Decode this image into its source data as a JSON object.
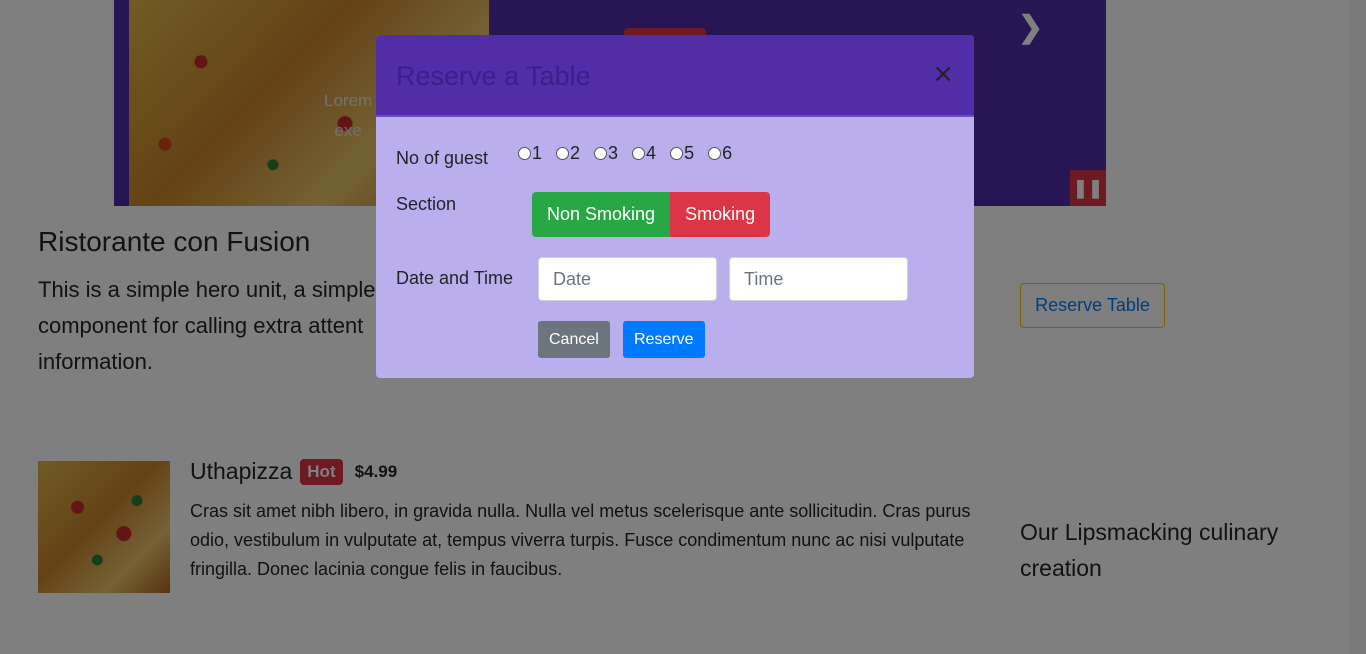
{
  "carousel": {
    "caption": "Lorem\nexe",
    "next_icon": "chevron-right-icon",
    "pause_icon": "pause-icon"
  },
  "hero": {
    "title": "Ristorante con Fusion",
    "lead": "This is a simple hero unit, a simple component for calling extra attent information.",
    "reserve_label": "Reserve Table"
  },
  "featured": {
    "title": "Uthapizza",
    "badge": "Hot",
    "price": "$4.99",
    "description": "Cras sit amet nibh libero, in gravida nulla. Nulla vel metus scelerisque ante sollicitudin. Cras purus odio, vestibulum in vulputate at, tempus viverra turpis. Fusce condimentum nunc ac nisi vulputate fringilla. Donec lacinia congue felis in faucibus.",
    "side_text": "Our Lipsmacking culinary creation"
  },
  "modal": {
    "title": "Reserve a Table",
    "close": "×",
    "guest_label": "No of guest",
    "guest_options": [
      "1",
      "2",
      "3",
      "4",
      "5",
      "6"
    ],
    "section_label": "Section",
    "section_options": [
      "Non Smoking",
      "Smoking"
    ],
    "datetime_label": "Date and Time",
    "date_placeholder": "Date",
    "time_placeholder": "Time",
    "cancel_label": "Cancel",
    "reserve_label": "Reserve"
  },
  "colors": {
    "brand": "#512da8",
    "modal_body": "#bbaeec",
    "success": "#28a745",
    "danger": "#dc3545",
    "primary": "#007bff",
    "secondary": "#6c757d"
  }
}
